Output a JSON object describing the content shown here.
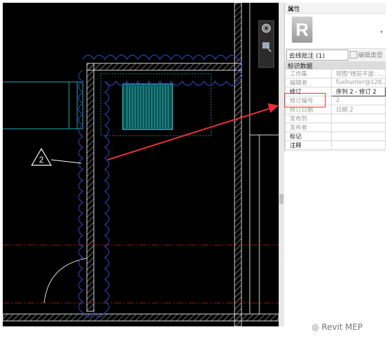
{
  "properties": {
    "title": "属性",
    "close": "×",
    "type_selector": "云线批注 (1)",
    "edit_type": "编辑类型",
    "section": "标识数据",
    "rows": [
      {
        "key": "工作集",
        "value": "视图\"楼层平面: ..."
      },
      {
        "key": "编辑者",
        "value": "fuxhunter@126..."
      },
      {
        "key": "修订",
        "value": "序列 2 - 修订 2"
      },
      {
        "key": "修订编号",
        "value": "2"
      },
      {
        "key": "修订日期",
        "value": "日期 2"
      },
      {
        "key": "发布到",
        "value": ""
      },
      {
        "key": "发布者",
        "value": ""
      },
      {
        "key": "标记",
        "value": ""
      },
      {
        "key": "注释",
        "value": ""
      }
    ]
  },
  "drawing": {
    "tag_number": "2"
  },
  "watermark": "Revit MEP",
  "colors": {
    "viewport_bg": "#000000",
    "revision_cloud": "#2c3ea8",
    "annotation_arrow": "#e8303a",
    "highlight_box": "#e33333",
    "duct": "#1fb0b0",
    "wall": "#d9d9d9",
    "grid_line": "#a0141e"
  },
  "icons": [
    "steering-wheel-icon",
    "zoom-icon",
    "revit-logo-icon",
    "dropdown-icon",
    "edit-type-icon",
    "wechat-icon"
  ]
}
